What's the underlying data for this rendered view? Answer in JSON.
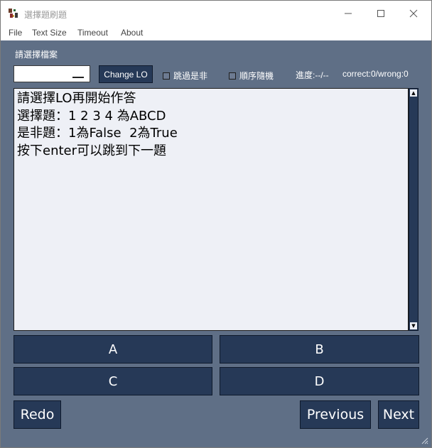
{
  "window": {
    "title": "選擇題刷題"
  },
  "menu": [
    "File",
    "Text Size",
    "Timeout",
    "About"
  ],
  "toolbar": {
    "prompt": "請選擇檔案",
    "file_select_value": "",
    "change_button": "Change LO",
    "skip_tf_label": "跳過是非",
    "skip_tf_checked": false,
    "shuffle_label": "順序隨機",
    "shuffle_checked": false,
    "progress": "進度:--/--",
    "score": "correct:0/wrong:0"
  },
  "content": {
    "lines": [
      "請選擇LO再開始作答",
      "選擇題：1 2 3 4 為ABCD",
      "是非題：1為False  2為True",
      "按下enter可以跳到下一題"
    ]
  },
  "answers": [
    "A",
    "B",
    "C",
    "D"
  ],
  "nav": {
    "redo": "Redo",
    "previous": "Previous",
    "next": "Next"
  },
  "colors": {
    "background": "#5f6f86",
    "button": "#263957",
    "text_area": "#eef0f6",
    "checkbox": "#6d7b92"
  }
}
